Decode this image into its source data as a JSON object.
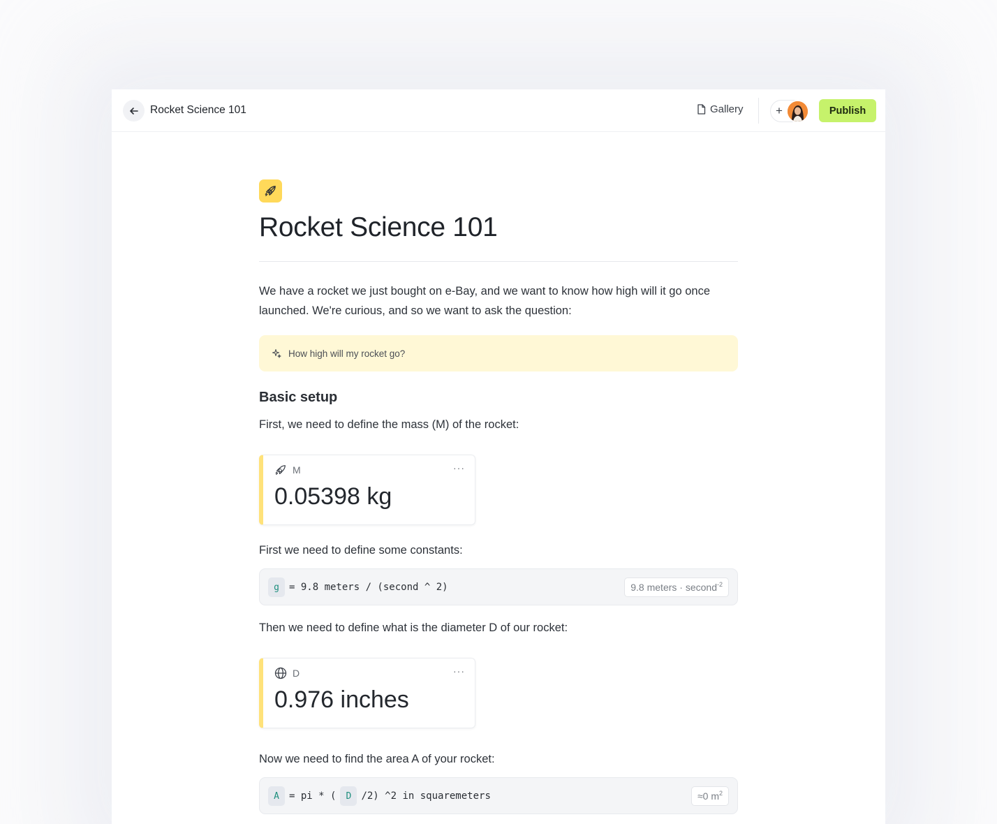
{
  "topbar": {
    "doc_title": "Rocket Science 101",
    "gallery_label": "Gallery",
    "add_label": "+",
    "publish_label": "Publish"
  },
  "page": {
    "icon": "rocket-icon",
    "title": "Rocket Science 101",
    "intro_line1": "We have a rocket we just bought on e-Bay, and we want to know how high will it go once",
    "intro_line2": "launched. We're curious, and so we want to ask the question:",
    "callout_text": "How high will my rocket go?",
    "section_heading": "Basic setup",
    "mass_intro": "First, we need to define the mass (M) of the rocket:",
    "mass_card": {
      "icon": "rocket-icon",
      "name": "M",
      "value": "0.05398 kg",
      "menu": "···"
    },
    "constants_intro": "First we need to define some constants:",
    "g_code": {
      "var": "g",
      "expr": "= 9.8 meters / (second ^ 2)",
      "result": "9.8 meters · second",
      "result_exp": "-2"
    },
    "diameter_intro": "Then we need to define what is the diameter D of our rocket:",
    "diameter_card": {
      "icon": "globe-icon",
      "name": "D",
      "value": "0.976 inches",
      "menu": "···"
    },
    "area_intro": "Now we need to find the area A of your rocket:",
    "a_code": {
      "var": "A",
      "expr1": "= pi * (",
      "ref": "D",
      "expr2": "/2) ^2 in squaremeters",
      "result": "≈0 m",
      "result_exp": "2"
    }
  },
  "colors": {
    "publish_bg": "#c6f26b",
    "callout_bg": "#fff8d6",
    "page_icon_bg": "#ffd95a",
    "card_accent": "#ffe27a",
    "code_token": "#1f8f7e"
  }
}
